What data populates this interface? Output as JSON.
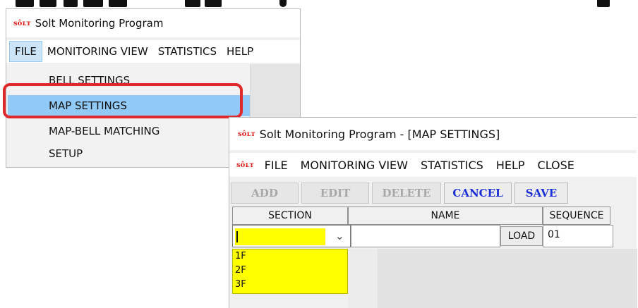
{
  "menu_window": {
    "logo": "sôʟт",
    "title": "Solt Monitoring Program",
    "menu": [
      "FILE",
      "MONITORING VIEW",
      "STATISTICS",
      "HELP"
    ],
    "file_menu_items": [
      "BELL SETTINGS",
      "MAP SETTINGS",
      "MAP-BELL MATCHING",
      "SETUP"
    ],
    "highlighted_item": "MAP SETTINGS",
    "highlight_color": "#e0292b"
  },
  "map_window": {
    "logo": "sôʟт",
    "title": "Solt Monitoring Program - [MAP SETTINGS]",
    "menu_logo": "sôʟт",
    "menu": [
      "FILE",
      "MONITORING VIEW",
      "STATISTICS",
      "HELP",
      "CLOSE"
    ],
    "toolbar": {
      "add": "ADD",
      "edit": "EDIT",
      "delete": "DELETE",
      "cancel": "CANCEL",
      "save": "SAVE"
    },
    "columns": {
      "section": "SECTION",
      "name": "NAME",
      "sequence": "SEQUENCE"
    },
    "row": {
      "section": "",
      "name": "",
      "load": "LOAD",
      "sequence": "01"
    },
    "section_options": [
      "1F",
      "2F",
      "3F"
    ],
    "active_button_color": "#1c2fd6",
    "combo_fill_color": "#ffff00"
  }
}
